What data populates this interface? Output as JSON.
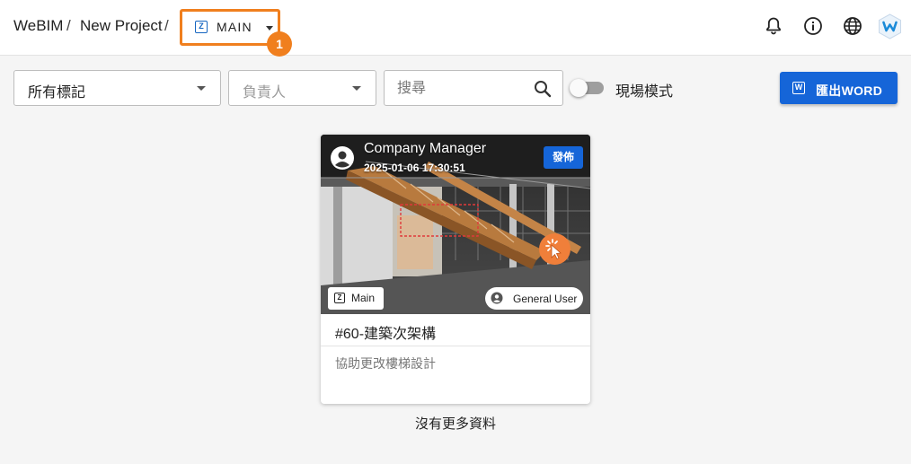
{
  "breadcrumb": {
    "items": [
      "WeBIM",
      "New Project"
    ],
    "separator": "/"
  },
  "zone_select": {
    "icon": "zone-z-icon",
    "label": "MAIN"
  },
  "step_badge": "1",
  "header_icons": [
    "bell-icon",
    "info-icon",
    "globe-icon",
    "webim-logo-icon"
  ],
  "toolbar": {
    "tag_filter": "所有標記",
    "assignee_placeholder": "負責人",
    "search_placeholder": "搜尋",
    "site_mode_label": "現場模式",
    "site_mode_on": false,
    "export_label": "匯出WORD"
  },
  "card": {
    "author": "Company Manager",
    "datetime": "2025-01-06 17:30:51",
    "status": "發佈",
    "zone_label": "Main",
    "user_label": "General User",
    "title": "#60-建築次架構",
    "description": "協助更改樓梯設計"
  },
  "footer_text": "沒有更多資料",
  "colors": {
    "accent_orange": "#f07f1e",
    "primary_blue": "#1565d8",
    "background": "#f5f5f5"
  }
}
